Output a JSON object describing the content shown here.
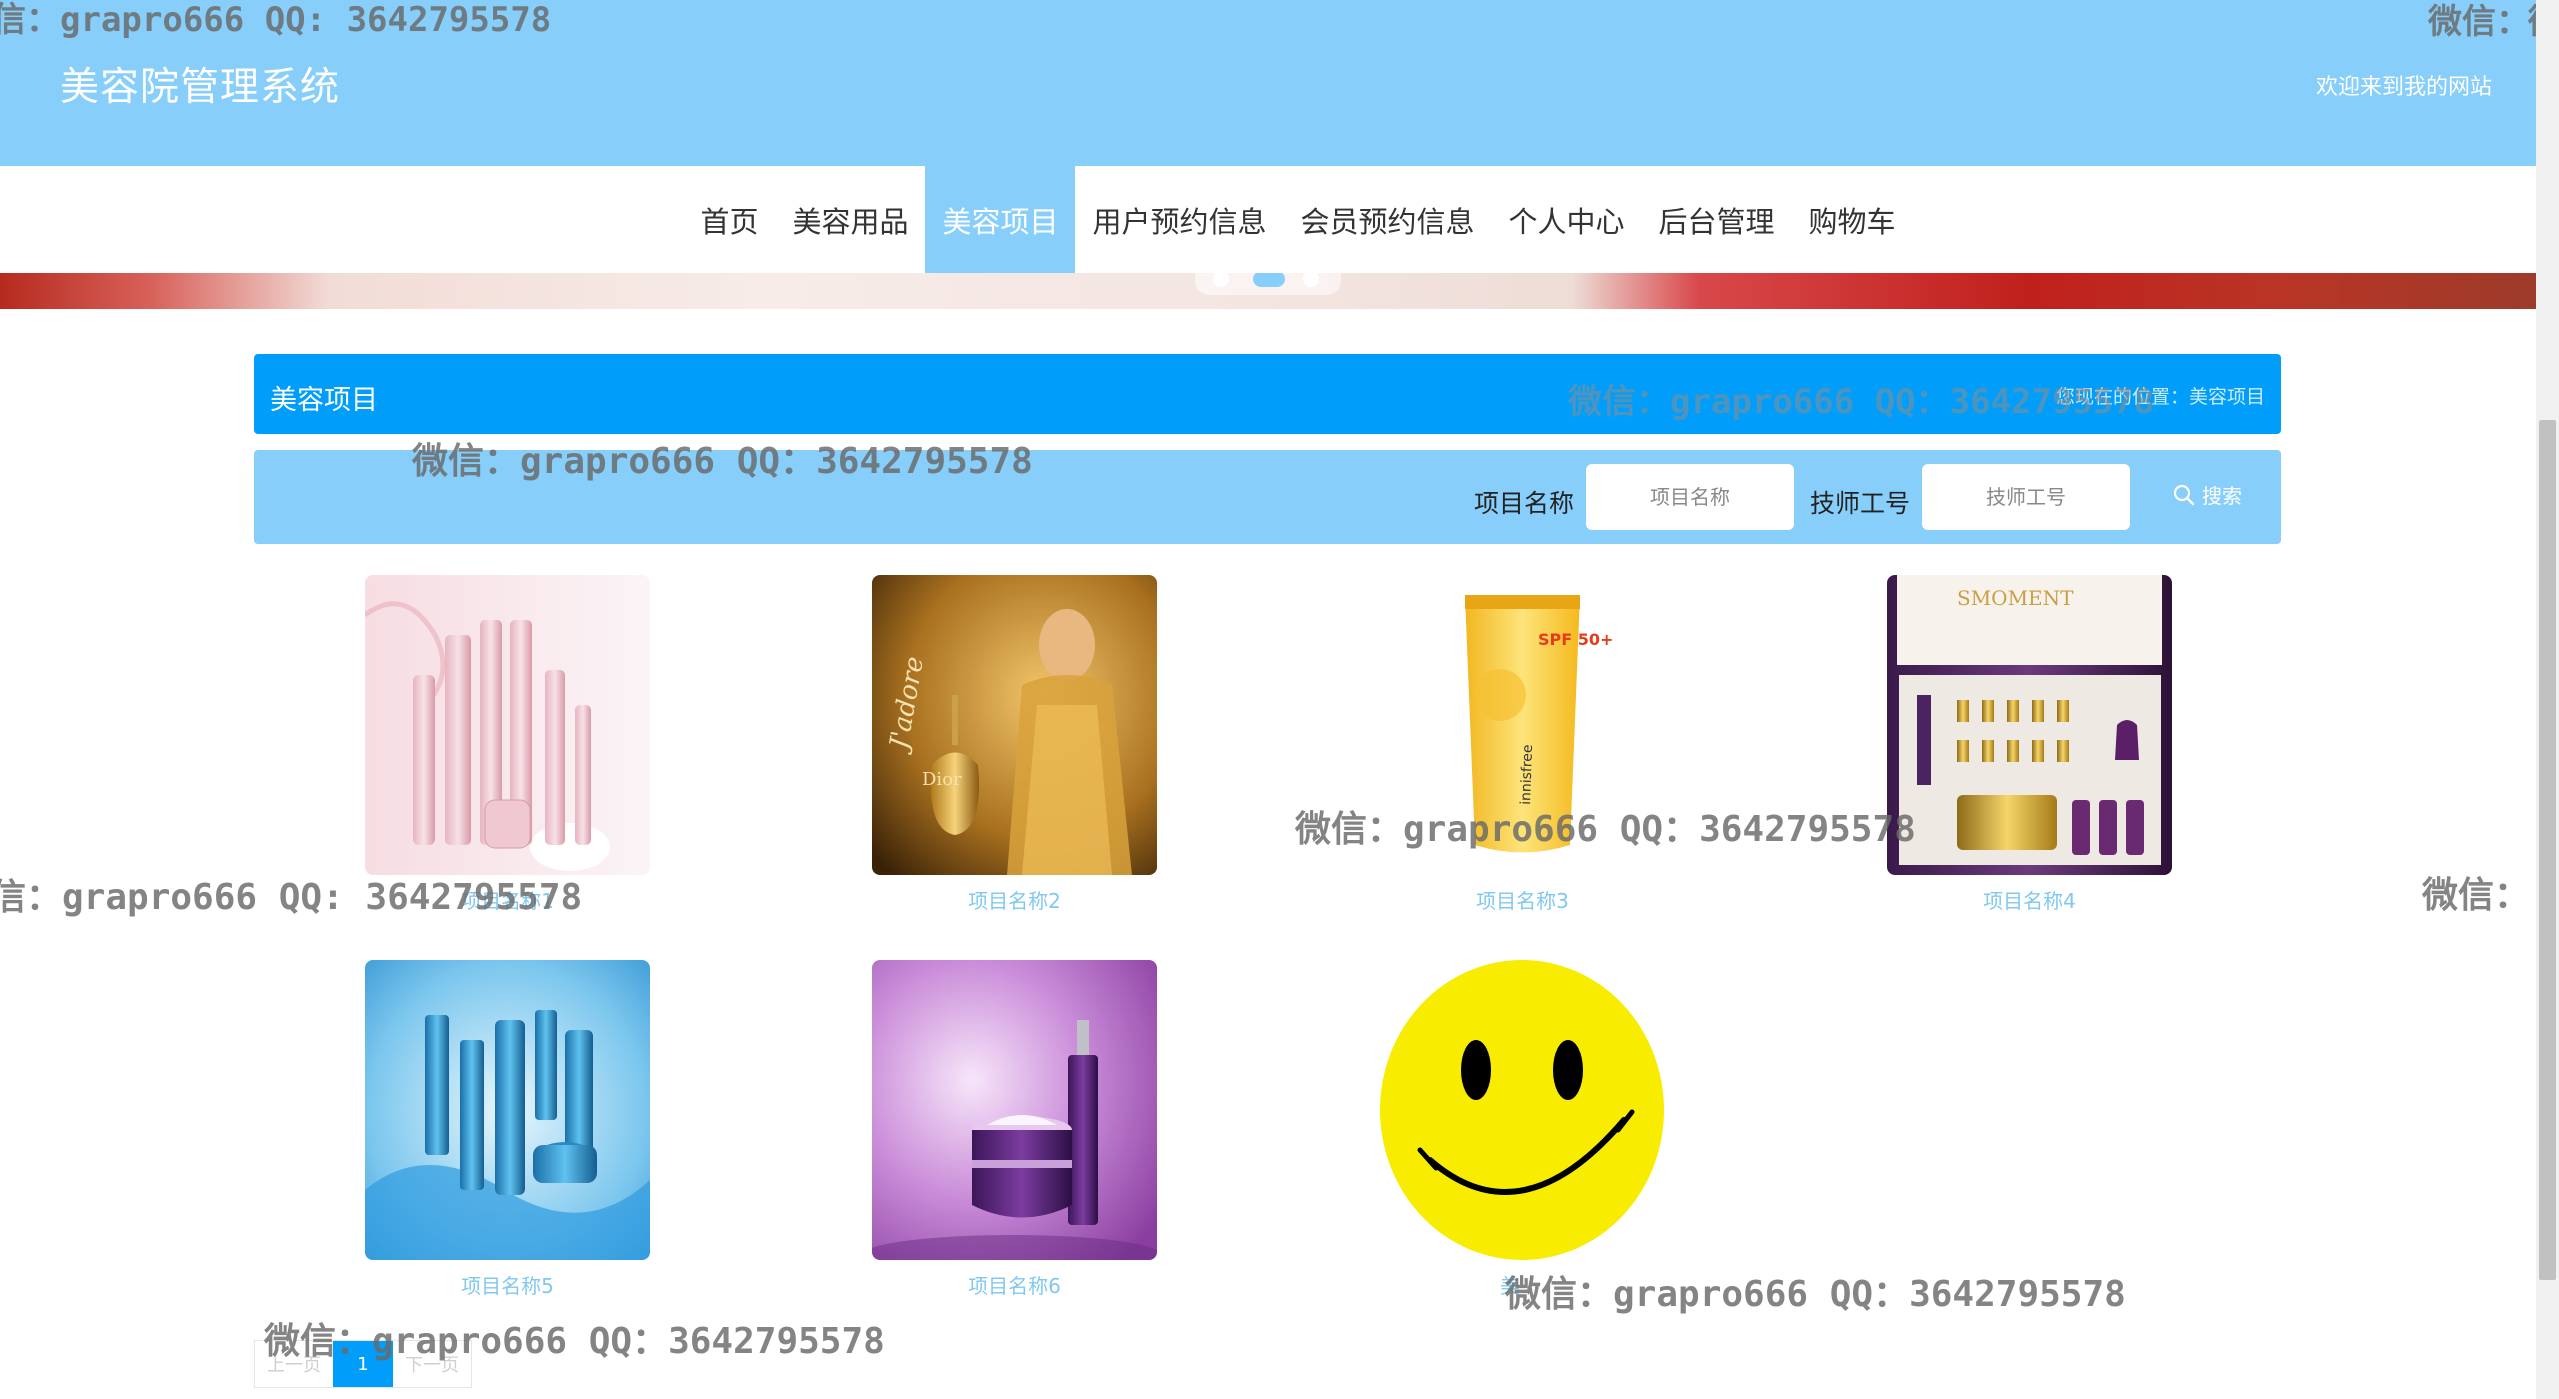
{
  "header": {
    "site_title": "美容院管理系统",
    "welcome": "欢迎来到我的网站"
  },
  "nav": {
    "items": [
      {
        "label": "首页"
      },
      {
        "label": "美容用品"
      },
      {
        "label": "美容项目",
        "active": true
      },
      {
        "label": "用户预约信息"
      },
      {
        "label": "会员预约信息"
      },
      {
        "label": "个人中心"
      },
      {
        "label": "后台管理"
      },
      {
        "label": "购物车"
      }
    ]
  },
  "section": {
    "title": "美容项目",
    "breadcrumb": "您现在的位置：美容项目"
  },
  "search": {
    "name_label": "项目名称",
    "name_placeholder": "项目名称",
    "tech_label": "技师工号",
    "tech_placeholder": "技师工号",
    "button_label": "搜索"
  },
  "products": [
    {
      "name": "项目名称1"
    },
    {
      "name": "项目名称2"
    },
    {
      "name": "项目名称3"
    },
    {
      "name": "项目名称4"
    },
    {
      "name": "项目名称5"
    },
    {
      "name": "项目名称6"
    },
    {
      "name": "美"
    }
  ],
  "product_images": [
    {
      "brand": "Dior",
      "script": "J'adore"
    },
    {
      "brand": "innisfree",
      "spf": "SPF 50+"
    },
    {
      "brand": "SMOMENT"
    }
  ],
  "pagination": {
    "prev": "上一页",
    "current": "1",
    "next": "下一页"
  },
  "watermark": {
    "text": "微信：grapro666 QQ：3642795578",
    "fragment_left": "信：grapro666 QQ: 3642795578",
    "fragment_right": "微信：",
    "fragment_top_left": "信：grapro666 QQ: 3642795578",
    "fragment_top_right": "微信：",
    "fragment_top_right_tail": "微"
  },
  "colors": {
    "header": "#87cefa",
    "accent": "#009efa",
    "link": "#80c8f0"
  }
}
